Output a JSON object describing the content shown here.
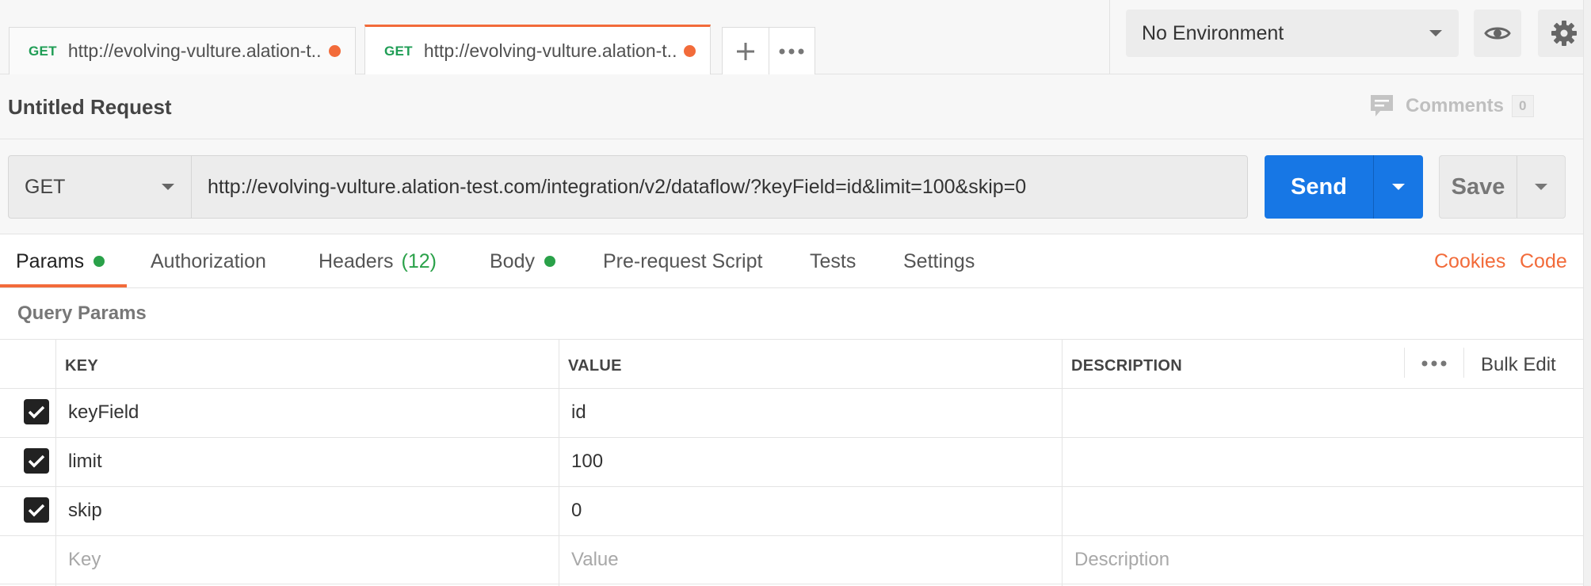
{
  "tabs": [
    {
      "method": "GET",
      "url": "http://evolving-vulture.alation-t..."
    },
    {
      "method": "GET",
      "url": "http://evolving-vulture.alation-t..."
    }
  ],
  "environment": {
    "selected": "No Environment"
  },
  "request": {
    "title": "Untitled Request",
    "comments_label": "Comments",
    "comments_count": "0",
    "method": "GET",
    "url": "http://evolving-vulture.alation-test.com/integration/v2/dataflow/?keyField=id&limit=100&skip=0",
    "send_label": "Send",
    "save_label": "Save"
  },
  "request_tabs": {
    "params": "Params",
    "authorization": "Authorization",
    "headers": "Headers",
    "headers_count": "(12)",
    "body": "Body",
    "prerequest": "Pre-request Script",
    "tests": "Tests",
    "settings": "Settings",
    "cookies": "Cookies",
    "code": "Code"
  },
  "query_params": {
    "section_label": "Query Params",
    "headers": {
      "key": "KEY",
      "value": "VALUE",
      "description": "DESCRIPTION"
    },
    "bulk_edit": "Bulk Edit",
    "rows": [
      {
        "checked": true,
        "key": "keyField",
        "value": "id",
        "description": ""
      },
      {
        "checked": true,
        "key": "limit",
        "value": "100",
        "description": ""
      },
      {
        "checked": true,
        "key": "skip",
        "value": "0",
        "description": ""
      }
    ],
    "placeholders": {
      "key": "Key",
      "value": "Value",
      "description": "Description"
    }
  },
  "colors": {
    "accent": "#f26b3a",
    "primary": "#1777e5",
    "success": "#2aa149"
  }
}
